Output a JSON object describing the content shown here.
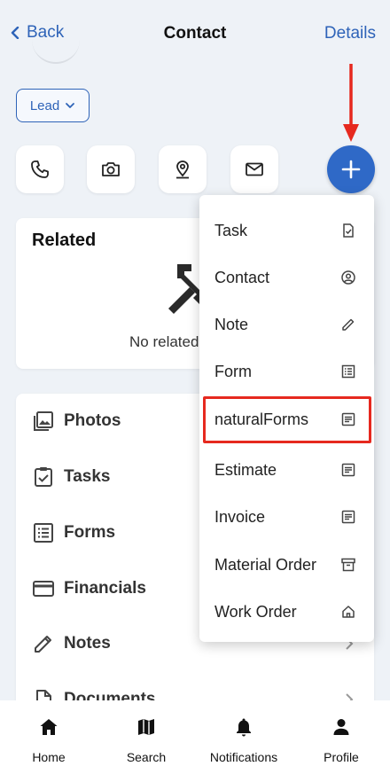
{
  "header": {
    "back_label": "Back",
    "title": "Contact",
    "details_label": "Details"
  },
  "status_pill": {
    "label": "Lead"
  },
  "quick_actions": [
    {
      "icon": "phone-icon"
    },
    {
      "icon": "camera-icon"
    },
    {
      "icon": "location-pin-icon"
    },
    {
      "icon": "mail-icon"
    }
  ],
  "fab": {
    "icon": "plus-icon"
  },
  "related": {
    "title": "Related",
    "empty_text": "No related"
  },
  "sections": [
    {
      "label": "Photos",
      "icon": "photos-icon"
    },
    {
      "label": "Tasks",
      "icon": "task-check-icon"
    },
    {
      "label": "Forms",
      "icon": "forms-icon"
    },
    {
      "label": "Financials",
      "icon": "credit-card-icon"
    },
    {
      "label": "Notes",
      "icon": "pencil-icon"
    },
    {
      "label": "Documents",
      "icon": "document-icon"
    }
  ],
  "create_menu": {
    "items": [
      {
        "label": "Task",
        "icon": "task-check-icon"
      },
      {
        "label": "Contact",
        "icon": "contact-icon"
      },
      {
        "label": "Note",
        "icon": "pencil-icon"
      },
      {
        "label": "Form",
        "icon": "forms-icon"
      },
      {
        "label": "naturalForms",
        "icon": "document-icon",
        "highlighted": true
      },
      {
        "label": "Estimate",
        "icon": "document-icon"
      },
      {
        "label": "Invoice",
        "icon": "document-icon"
      },
      {
        "label": "Material Order",
        "icon": "archive-icon"
      },
      {
        "label": "Work Order",
        "icon": "home-outline-icon"
      }
    ]
  },
  "bottom_nav": {
    "items": [
      {
        "label": "Home",
        "icon": "home-icon"
      },
      {
        "label": "Search",
        "icon": "map-icon"
      },
      {
        "label": "Notifications",
        "icon": "bell-icon"
      },
      {
        "label": "Profile",
        "icon": "person-icon"
      }
    ]
  },
  "colors": {
    "accent": "#2e63b8",
    "fab": "#2f69c7",
    "annotation": "#e6291f",
    "background": "#eef2f7"
  }
}
